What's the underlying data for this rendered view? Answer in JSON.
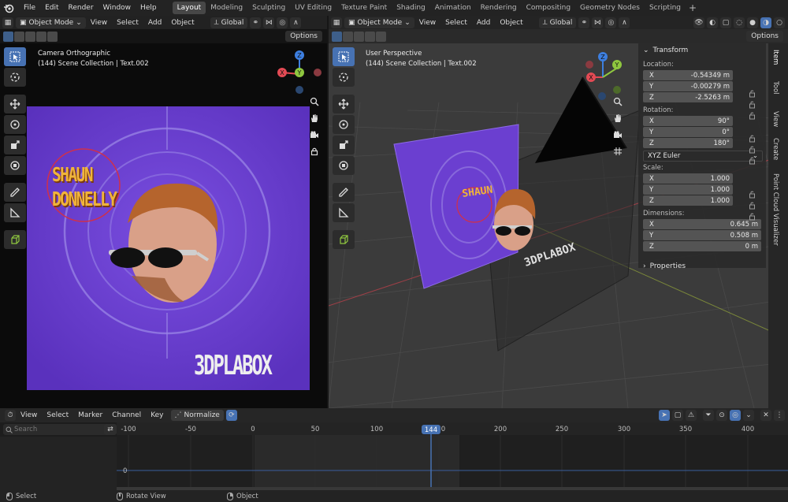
{
  "menubar": {
    "items": [
      "File",
      "Edit",
      "Render",
      "Window",
      "Help"
    ],
    "workspaces": [
      "Layout",
      "Modeling",
      "Sculpting",
      "UV Editing",
      "Texture Paint",
      "Shading",
      "Animation",
      "Rendering",
      "Compositing",
      "Geometry Nodes",
      "Scripting"
    ],
    "active_workspace": "Layout",
    "add_label": "+"
  },
  "viewport_left": {
    "mode": "Object Mode",
    "menus": [
      "View",
      "Select",
      "Add",
      "Object"
    ],
    "orientation": "Global",
    "options": "Options",
    "info_line1": "Camera Orthographic",
    "info_line2": "(144) Scene Collection | Text.002",
    "poster_title_line1": "SHAUN",
    "poster_title_line2": "DONNELLY",
    "poster_logo": "3DPLABOX"
  },
  "viewport_right": {
    "mode": "Object Mode",
    "menus": [
      "View",
      "Select",
      "Add",
      "Object"
    ],
    "orientation": "Global",
    "options": "Options",
    "info_line1": "User Perspective",
    "info_line2": "(144) Scene Collection | Text.002"
  },
  "gizmo": {
    "x": "X",
    "y": "Y",
    "z": "Z"
  },
  "npanel": {
    "section": "Transform",
    "location_label": "Location:",
    "location": [
      {
        "axis": "X",
        "value": "-0.54349 m"
      },
      {
        "axis": "Y",
        "value": "-0.00279 m"
      },
      {
        "axis": "Z",
        "value": "-2.5263 m"
      }
    ],
    "rotation_label": "Rotation:",
    "rotation": [
      {
        "axis": "X",
        "value": "90°"
      },
      {
        "axis": "Y",
        "value": "0°"
      },
      {
        "axis": "Z",
        "value": "180°"
      }
    ],
    "rotation_mode": "XYZ Euler",
    "scale_label": "Scale:",
    "scale": [
      {
        "axis": "X",
        "value": "1.000"
      },
      {
        "axis": "Y",
        "value": "1.000"
      },
      {
        "axis": "Z",
        "value": "1.000"
      }
    ],
    "dimensions_label": "Dimensions:",
    "dimensions": [
      {
        "axis": "X",
        "value": "0.645 m"
      },
      {
        "axis": "Y",
        "value": "0.508 m"
      },
      {
        "axis": "Z",
        "value": "0 m"
      }
    ],
    "properties_section": "Properties",
    "tabs": [
      "Item",
      "Tool",
      "View",
      "Create",
      "Point Cloud Visualizer"
    ]
  },
  "timeline": {
    "menus": [
      "View",
      "Select",
      "Marker",
      "Channel",
      "Key"
    ],
    "normalize": "Normalize",
    "search_placeholder": "Search",
    "ruler": [
      "-100",
      "-50",
      "0",
      "50",
      "100",
      "150",
      "200",
      "250",
      "300",
      "350",
      "400"
    ],
    "current_frame": "144",
    "zero_label": "0"
  },
  "statusbar": {
    "select": "Select",
    "rotate": "Rotate View",
    "object": "Object"
  },
  "colors": {
    "accent": "#4772b3",
    "poster_purple": "#6b3fd0",
    "axis_x": "#e34a54",
    "axis_y": "#8fc73f",
    "axis_z": "#3d7fe0"
  }
}
